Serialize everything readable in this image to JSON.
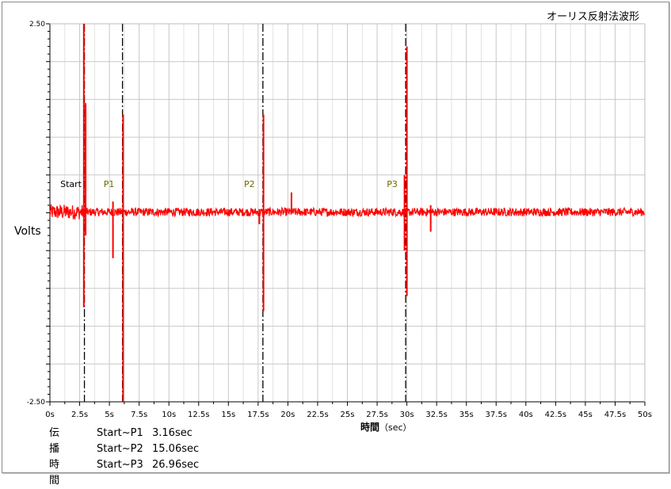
{
  "chart_data": {
    "type": "line",
    "title": "オーリス反射法波形",
    "ylabel": "Volts",
    "xlabel": "時間",
    "xunit": "（sec）",
    "xlim": [
      0,
      50
    ],
    "ylim": [
      -2.5,
      2.5
    ],
    "yticks": [
      "2.50",
      "-2.50"
    ],
    "xticks": [
      "0s",
      "2.5s",
      "5s",
      "7.5s",
      "10s",
      "12.5s",
      "15s",
      "17.5s",
      "20s",
      "22.5s",
      "25s",
      "27.5s",
      "30s",
      "32.5s",
      "35s",
      "37.5s",
      "40s",
      "42.5s",
      "45s",
      "47.5s",
      "50s"
    ],
    "series_color": "#ff0000",
    "markers": [
      {
        "label": "Start",
        "x": 2.9,
        "color": "#000000"
      },
      {
        "label": "P1",
        "x": 6.1,
        "color": "#6b6b00"
      },
      {
        "label": "P2",
        "x": 17.9,
        "color": "#6b6b00"
      },
      {
        "label": "P3",
        "x": 29.9,
        "color": "#6b6b00"
      }
    ],
    "spikes": [
      {
        "x": 2.85,
        "min": -1.25,
        "max": 2.5
      },
      {
        "x": 3.0,
        "min": -0.3,
        "max": 1.45
      },
      {
        "x": 5.3,
        "min": -0.6,
        "max": 0.15
      },
      {
        "x": 6.15,
        "min": -2.5,
        "max": 1.3
      },
      {
        "x": 17.6,
        "min": -0.15,
        "max": 0.05
      },
      {
        "x": 17.95,
        "min": -1.3,
        "max": 1.3
      },
      {
        "x": 20.3,
        "min": 0.0,
        "max": 0.27
      },
      {
        "x": 29.8,
        "min": -0.5,
        "max": 0.5
      },
      {
        "x": 30.0,
        "min": -1.1,
        "max": 2.2
      },
      {
        "x": 32.0,
        "min": -0.25,
        "max": 0.1
      }
    ]
  },
  "summary": {
    "label": "伝播時間",
    "rows": [
      {
        "key": "Start~P1",
        "value": "3.16sec"
      },
      {
        "key": "Start~P2",
        "value": "15.06sec"
      },
      {
        "key": "Start~P3",
        "value": "26.96sec"
      }
    ]
  }
}
